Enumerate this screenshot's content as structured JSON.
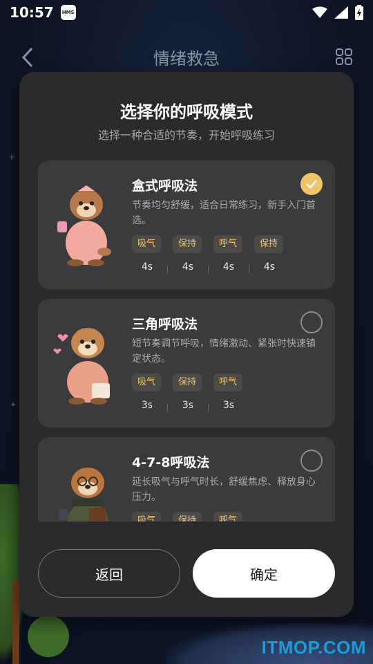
{
  "status_bar": {
    "time": "10:57",
    "badge": "HMS"
  },
  "app_bar": {
    "title": "情绪救急"
  },
  "modal": {
    "title": "选择你的呼吸模式",
    "subtitle": "选择一种合适的节奏，开始呼吸练习",
    "options": [
      {
        "title": "盒式呼吸法",
        "description": "节奏均匀舒缓，适合日常练习，新手入门首选。",
        "selected": true,
        "steps": [
          {
            "label": "吸气",
            "duration": "4s"
          },
          {
            "label": "保持",
            "duration": "4s"
          },
          {
            "label": "呼气",
            "duration": "4s"
          },
          {
            "label": "保持",
            "duration": "4s"
          }
        ]
      },
      {
        "title": "三角呼吸法",
        "description": "短节奏调节呼吸，情绪激动、紧张时快速镇定状态。",
        "selected": false,
        "steps": [
          {
            "label": "吸气",
            "duration": "3s"
          },
          {
            "label": "保持",
            "duration": "3s"
          },
          {
            "label": "呼气",
            "duration": "3s"
          }
        ]
      },
      {
        "title": "4-7-8呼吸法",
        "description": "延长吸气与呼气时长，舒缓焦虑、释放身心压力。",
        "selected": false,
        "steps": [
          {
            "label": "吸气",
            "duration": ""
          },
          {
            "label": "保持",
            "duration": ""
          },
          {
            "label": "呼气",
            "duration": ""
          }
        ]
      }
    ],
    "back_label": "返回",
    "confirm_label": "确定"
  },
  "watermark": "ITMOP.COM",
  "colors": {
    "accent": "#f2c46a",
    "chip_text": "#f0c572",
    "modal_bg": "#2b2b2d",
    "card_bg": "#3b3b3d"
  }
}
